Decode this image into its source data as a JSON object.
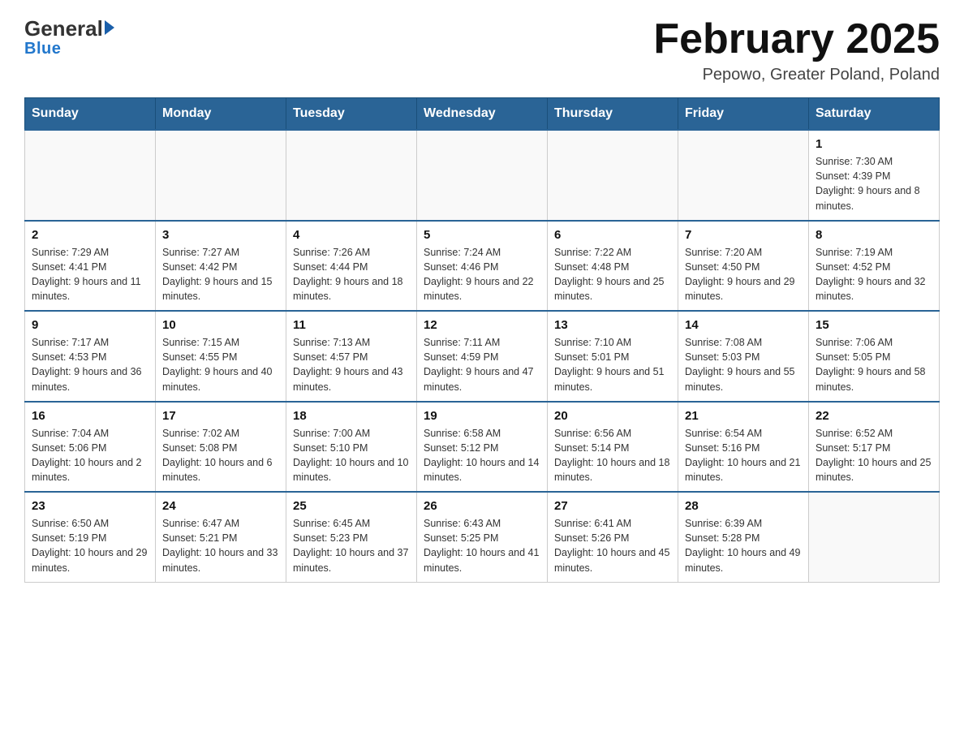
{
  "header": {
    "logo_general": "General",
    "logo_blue": "Blue",
    "month_title": "February 2025",
    "location": "Pepowo, Greater Poland, Poland"
  },
  "days_of_week": [
    "Sunday",
    "Monday",
    "Tuesday",
    "Wednesday",
    "Thursday",
    "Friday",
    "Saturday"
  ],
  "weeks": [
    {
      "days": [
        {
          "date": "",
          "info": ""
        },
        {
          "date": "",
          "info": ""
        },
        {
          "date": "",
          "info": ""
        },
        {
          "date": "",
          "info": ""
        },
        {
          "date": "",
          "info": ""
        },
        {
          "date": "",
          "info": ""
        },
        {
          "date": "1",
          "info": "Sunrise: 7:30 AM\nSunset: 4:39 PM\nDaylight: 9 hours and 8 minutes."
        }
      ]
    },
    {
      "days": [
        {
          "date": "2",
          "info": "Sunrise: 7:29 AM\nSunset: 4:41 PM\nDaylight: 9 hours and 11 minutes."
        },
        {
          "date": "3",
          "info": "Sunrise: 7:27 AM\nSunset: 4:42 PM\nDaylight: 9 hours and 15 minutes."
        },
        {
          "date": "4",
          "info": "Sunrise: 7:26 AM\nSunset: 4:44 PM\nDaylight: 9 hours and 18 minutes."
        },
        {
          "date": "5",
          "info": "Sunrise: 7:24 AM\nSunset: 4:46 PM\nDaylight: 9 hours and 22 minutes."
        },
        {
          "date": "6",
          "info": "Sunrise: 7:22 AM\nSunset: 4:48 PM\nDaylight: 9 hours and 25 minutes."
        },
        {
          "date": "7",
          "info": "Sunrise: 7:20 AM\nSunset: 4:50 PM\nDaylight: 9 hours and 29 minutes."
        },
        {
          "date": "8",
          "info": "Sunrise: 7:19 AM\nSunset: 4:52 PM\nDaylight: 9 hours and 32 minutes."
        }
      ]
    },
    {
      "days": [
        {
          "date": "9",
          "info": "Sunrise: 7:17 AM\nSunset: 4:53 PM\nDaylight: 9 hours and 36 minutes."
        },
        {
          "date": "10",
          "info": "Sunrise: 7:15 AM\nSunset: 4:55 PM\nDaylight: 9 hours and 40 minutes."
        },
        {
          "date": "11",
          "info": "Sunrise: 7:13 AM\nSunset: 4:57 PM\nDaylight: 9 hours and 43 minutes."
        },
        {
          "date": "12",
          "info": "Sunrise: 7:11 AM\nSunset: 4:59 PM\nDaylight: 9 hours and 47 minutes."
        },
        {
          "date": "13",
          "info": "Sunrise: 7:10 AM\nSunset: 5:01 PM\nDaylight: 9 hours and 51 minutes."
        },
        {
          "date": "14",
          "info": "Sunrise: 7:08 AM\nSunset: 5:03 PM\nDaylight: 9 hours and 55 minutes."
        },
        {
          "date": "15",
          "info": "Sunrise: 7:06 AM\nSunset: 5:05 PM\nDaylight: 9 hours and 58 minutes."
        }
      ]
    },
    {
      "days": [
        {
          "date": "16",
          "info": "Sunrise: 7:04 AM\nSunset: 5:06 PM\nDaylight: 10 hours and 2 minutes."
        },
        {
          "date": "17",
          "info": "Sunrise: 7:02 AM\nSunset: 5:08 PM\nDaylight: 10 hours and 6 minutes."
        },
        {
          "date": "18",
          "info": "Sunrise: 7:00 AM\nSunset: 5:10 PM\nDaylight: 10 hours and 10 minutes."
        },
        {
          "date": "19",
          "info": "Sunrise: 6:58 AM\nSunset: 5:12 PM\nDaylight: 10 hours and 14 minutes."
        },
        {
          "date": "20",
          "info": "Sunrise: 6:56 AM\nSunset: 5:14 PM\nDaylight: 10 hours and 18 minutes."
        },
        {
          "date": "21",
          "info": "Sunrise: 6:54 AM\nSunset: 5:16 PM\nDaylight: 10 hours and 21 minutes."
        },
        {
          "date": "22",
          "info": "Sunrise: 6:52 AM\nSunset: 5:17 PM\nDaylight: 10 hours and 25 minutes."
        }
      ]
    },
    {
      "days": [
        {
          "date": "23",
          "info": "Sunrise: 6:50 AM\nSunset: 5:19 PM\nDaylight: 10 hours and 29 minutes."
        },
        {
          "date": "24",
          "info": "Sunrise: 6:47 AM\nSunset: 5:21 PM\nDaylight: 10 hours and 33 minutes."
        },
        {
          "date": "25",
          "info": "Sunrise: 6:45 AM\nSunset: 5:23 PM\nDaylight: 10 hours and 37 minutes."
        },
        {
          "date": "26",
          "info": "Sunrise: 6:43 AM\nSunset: 5:25 PM\nDaylight: 10 hours and 41 minutes."
        },
        {
          "date": "27",
          "info": "Sunrise: 6:41 AM\nSunset: 5:26 PM\nDaylight: 10 hours and 45 minutes."
        },
        {
          "date": "28",
          "info": "Sunrise: 6:39 AM\nSunset: 5:28 PM\nDaylight: 10 hours and 49 minutes."
        },
        {
          "date": "",
          "info": ""
        }
      ]
    }
  ]
}
